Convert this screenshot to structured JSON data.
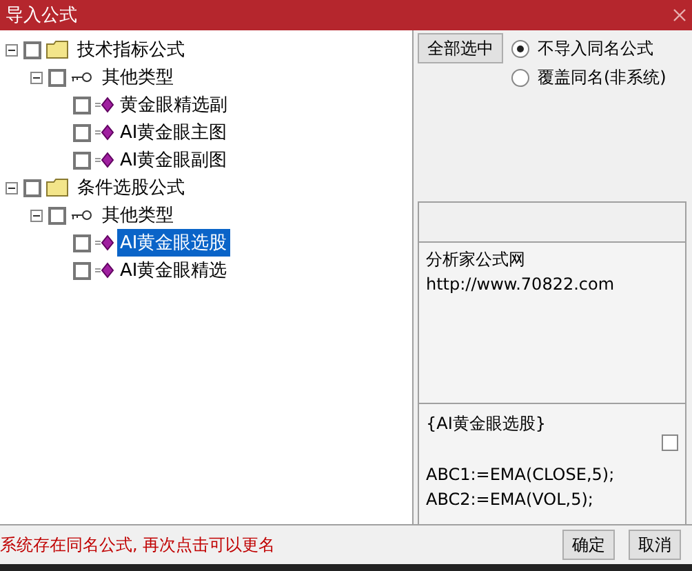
{
  "window": {
    "title": "导入公式"
  },
  "tree": [
    {
      "kind": "folder",
      "label": "技术指标公式",
      "checked": false,
      "expanded": true,
      "children": [
        {
          "kind": "type",
          "label": "其他类型",
          "checked": false,
          "expanded": true,
          "children": [
            {
              "kind": "formula",
              "label": "黄金眼精选副",
              "checked": false,
              "selected": false
            },
            {
              "kind": "formula",
              "label": "AI黄金眼主图",
              "checked": false,
              "selected": false
            },
            {
              "kind": "formula",
              "label": "AI黄金眼副图",
              "checked": false,
              "selected": false
            }
          ]
        }
      ]
    },
    {
      "kind": "folder",
      "label": "条件选股公式",
      "checked": false,
      "expanded": true,
      "children": [
        {
          "kind": "type",
          "label": "其他类型",
          "checked": false,
          "expanded": true,
          "children": [
            {
              "kind": "formula",
              "label": "AI黄金眼选股",
              "checked": false,
              "selected": true
            },
            {
              "kind": "formula",
              "label": "AI黄金眼精选",
              "checked": false,
              "selected": false
            }
          ]
        }
      ]
    }
  ],
  "select_all_button": "全部选中",
  "options": [
    {
      "label": "不导入同名公式",
      "selected": true
    },
    {
      "label": "覆盖同名(非系统)",
      "selected": false
    }
  ],
  "info": [
    "分析家公式网",
    "http://www.70822.com"
  ],
  "formula_preview": {
    "lines": [
      "{AI黄金眼选股}",
      "ABC1:=EMA(CLOSE,5);",
      "ABC2:=EMA(VOL,5);"
    ],
    "checked": false
  },
  "status": "系统存在同名公式, 再次点击可以更名",
  "buttons": [
    "确定",
    "取消"
  ]
}
